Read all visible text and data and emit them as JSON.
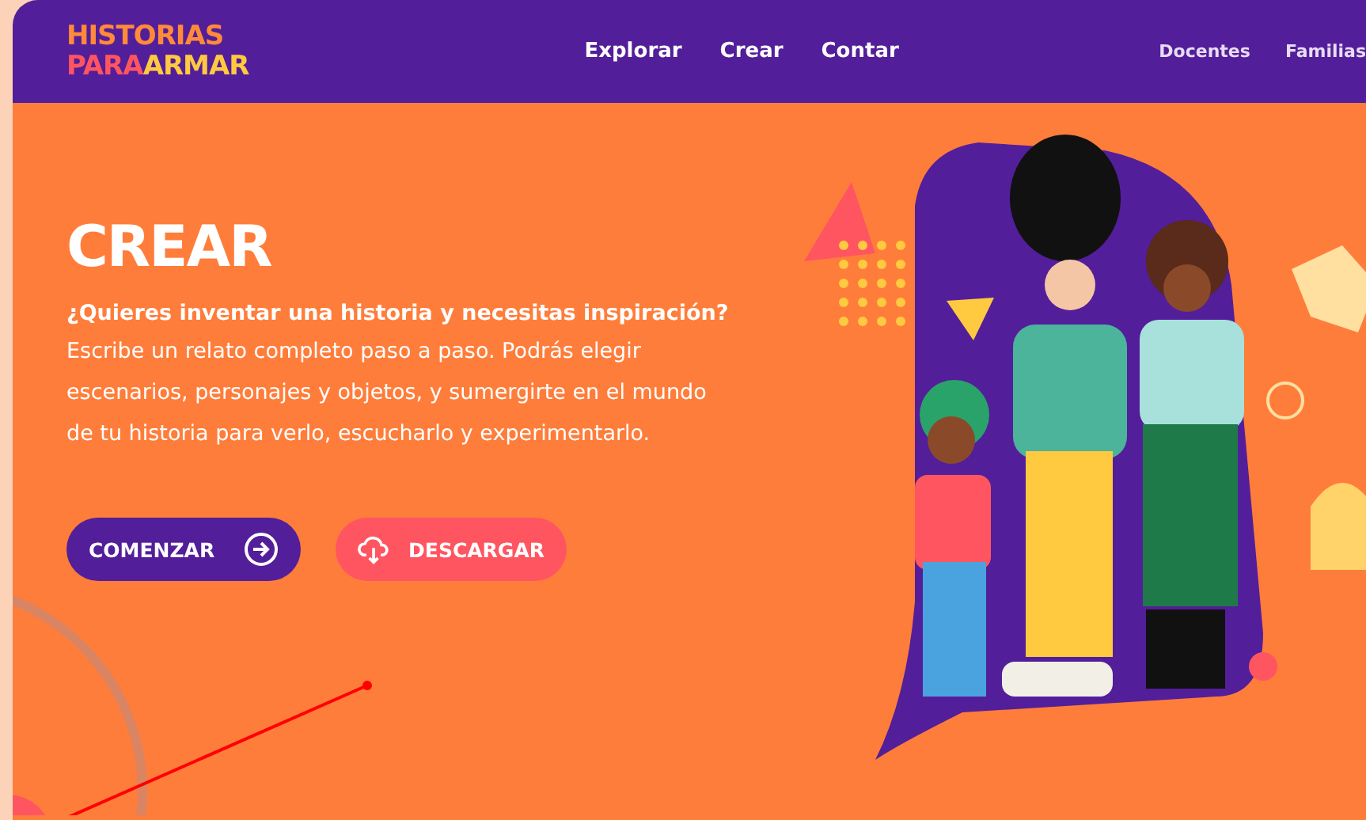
{
  "header": {
    "logo": {
      "line1": "HISTORIAS",
      "line2a": "PARA",
      "line2b": "ARMAR"
    },
    "nav": [
      {
        "label": "Explorar",
        "selected": false
      },
      {
        "label": "Crear",
        "selected": false
      },
      {
        "label": "Contar",
        "selected": false
      }
    ],
    "secondary_nav": [
      "Docentes",
      "Familias"
    ]
  },
  "hero": {
    "title": "CREAR",
    "lead": "¿Quieres inventar una historia y necesitas inspiración?",
    "body": "Escribe un relato completo paso a paso. Podrás elegir escenarios, personajes y objetos, y sumergirte en el mundo de tu historia para verlo, escucharlo y experimentarlo.",
    "buttons": [
      {
        "label": "COMENZAR",
        "kind": "primary"
      },
      {
        "label": "DESCARGAR",
        "kind": "download"
      }
    ]
  }
}
